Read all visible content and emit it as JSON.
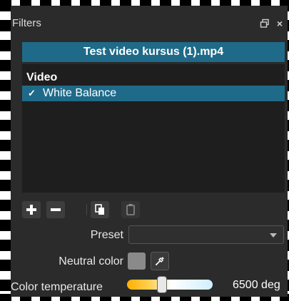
{
  "dock": {
    "title": "Filters",
    "close_glyph": "×"
  },
  "clip": {
    "name": "Test video kursus (1).mp4"
  },
  "filters": {
    "category": "Video",
    "items": [
      {
        "label": "White Balance",
        "enabled": true,
        "check_glyph": "✓"
      }
    ]
  },
  "toolbar": {
    "icons": [
      "plus-icon",
      "minus-icon",
      "copy-icon",
      "paste-icon"
    ]
  },
  "form": {
    "preset_label": "Preset",
    "preset_value": "",
    "neutral_color_label": "Neutral color",
    "neutral_color": "#8a8a8a",
    "temperature_label": "Color temperature",
    "temperature_value": "6500 deg",
    "temperature_fraction": 0.4
  },
  "colors": {
    "accent": "#1f6a88",
    "panel_bg": "#2b2b2b",
    "list_bg": "#1e1e1e"
  }
}
